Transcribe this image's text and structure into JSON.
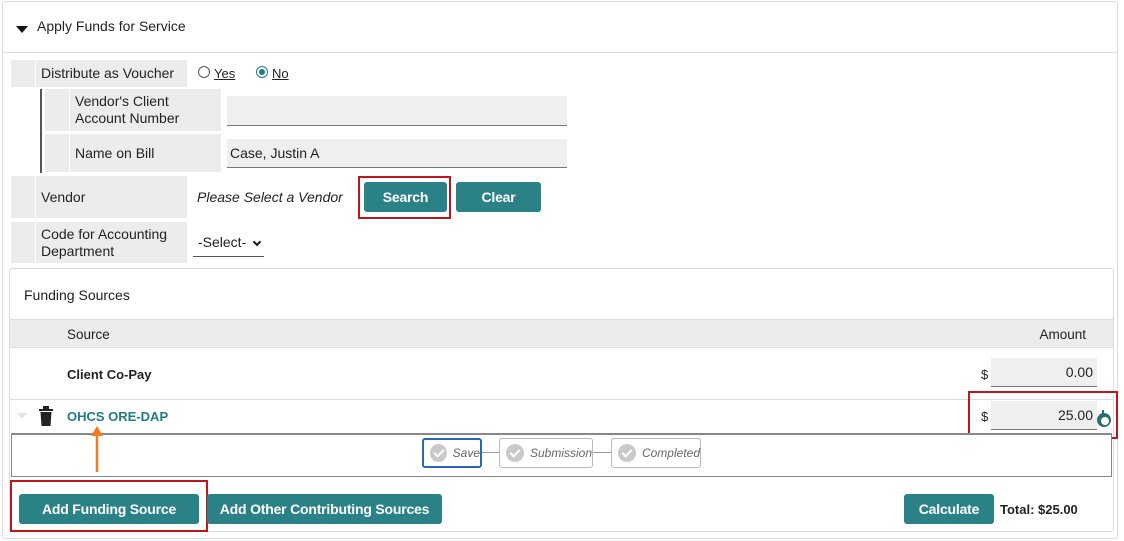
{
  "section": {
    "title": "Apply Funds for Service"
  },
  "voucher": {
    "label": "Distribute as Voucher",
    "options": [
      {
        "label": "Yes",
        "selected": false
      },
      {
        "label": "No",
        "selected": true
      }
    ]
  },
  "vendor_account": {
    "label_line1": "Vendor's Client",
    "label_line2": "Account Number",
    "value": ""
  },
  "name_on_bill": {
    "label": "Name on Bill",
    "value": "Case, Justin A"
  },
  "vendor": {
    "label": "Vendor",
    "placeholder": "Please Select a Vendor",
    "search_label": "Search",
    "clear_label": "Clear"
  },
  "accounting_code": {
    "label_line1": "Code for Accounting",
    "label_line2": "Department",
    "selected": "-Select-"
  },
  "funding": {
    "title": "Funding Sources",
    "columns": {
      "source": "Source",
      "amount": "Amount"
    },
    "rows": [
      {
        "source": "Client Co-Pay",
        "currency": "$",
        "amount": "0.00"
      },
      {
        "source": "OHCS ORE-DAP",
        "currency": "$",
        "amount": "25.00"
      }
    ],
    "steps": [
      {
        "label": "Save",
        "active": true
      },
      {
        "label": "Submission",
        "active": false
      },
      {
        "label": "Completed",
        "active": false
      }
    ],
    "add_funding_label": "Add Funding Source",
    "add_other_label": "Add Other Contributing Sources",
    "calculate_label": "Calculate",
    "total_text": "Total: $25.00"
  },
  "colors": {
    "accent": "#2b8286",
    "highlight": "#c0151b",
    "arrow": "#f07c1e"
  }
}
